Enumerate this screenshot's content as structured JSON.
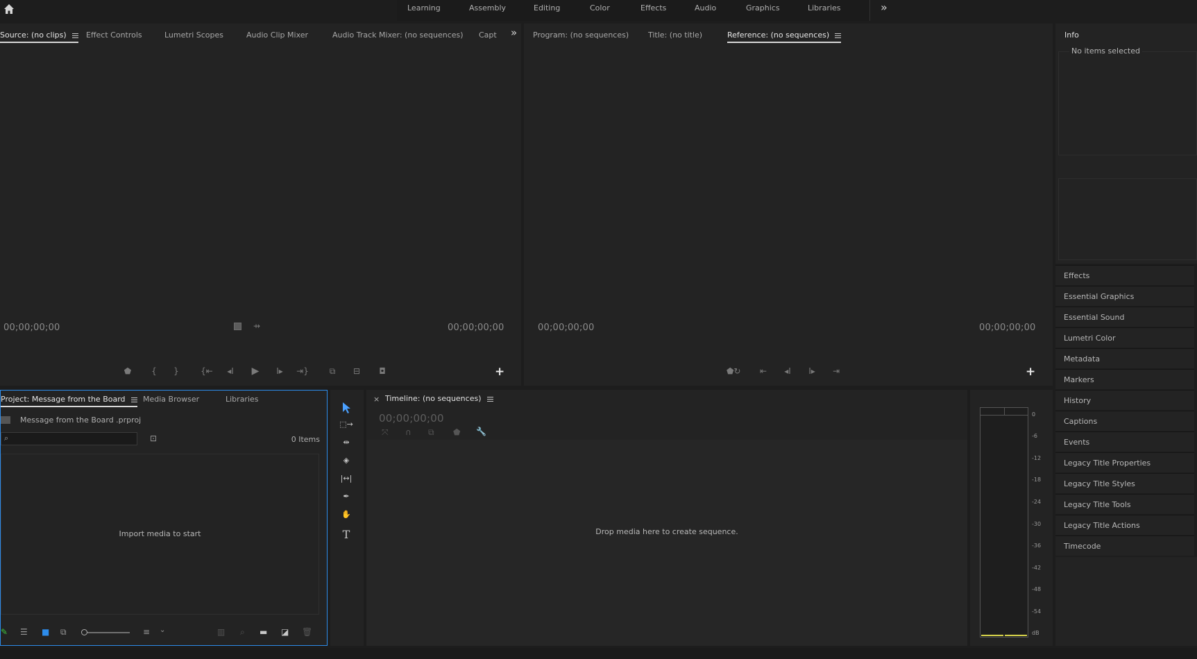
{
  "workspaces": {
    "tabs": [
      "Learning",
      "Assembly",
      "Editing",
      "Color",
      "Effects",
      "Audio",
      "Graphics",
      "Libraries"
    ],
    "more_label": "»"
  },
  "source_panel": {
    "tabs": [
      "Source: (no clips)",
      "Effect Controls",
      "Lumetri Scopes",
      "Audio Clip Mixer",
      "Audio Track Mixer: (no sequences)",
      "Capt"
    ],
    "overflow": "»",
    "timecode_left": "00;00;00;00",
    "timecode_right": "00;00;00;00"
  },
  "program_panel": {
    "tabs": [
      "Program: (no sequences)",
      "Title: (no title)",
      "Reference: (no sequences)"
    ],
    "timecode_left": "00;00;00;00",
    "timecode_right": "00;00;00;00"
  },
  "info_panel": {
    "title": "Info",
    "status": "No items selected"
  },
  "right_panels": [
    "Effects",
    "Essential Graphics",
    "Essential Sound",
    "Lumetri Color",
    "Metadata",
    "Markers",
    "History",
    "Captions",
    "Events",
    "Legacy Title Properties",
    "Legacy Title Styles",
    "Legacy Title Tools",
    "Legacy Title Actions",
    "Timecode"
  ],
  "project_panel": {
    "tabs": [
      "Project: Message from the Board",
      "Media Browser",
      "Libraries"
    ],
    "file_name": "Message from the Board .prproj",
    "search_placeholder": "",
    "item_count": "0 Items",
    "empty_message": "Import media to start"
  },
  "timeline_panel": {
    "close": "×",
    "title": "Timeline: (no sequences)",
    "timecode": "00;00;00;00",
    "empty_message": "Drop media here to create sequence."
  },
  "audio_meter": {
    "labels": [
      "0",
      "-6",
      "-12",
      "-18",
      "-24",
      "-30",
      "-36",
      "-42",
      "-48",
      "-54",
      "dB"
    ]
  },
  "colors": {
    "background": "#1d1d1d",
    "panel": "#232323",
    "accent_blue": "#2d8ceb",
    "meter_yellow": "#d8d44a"
  }
}
